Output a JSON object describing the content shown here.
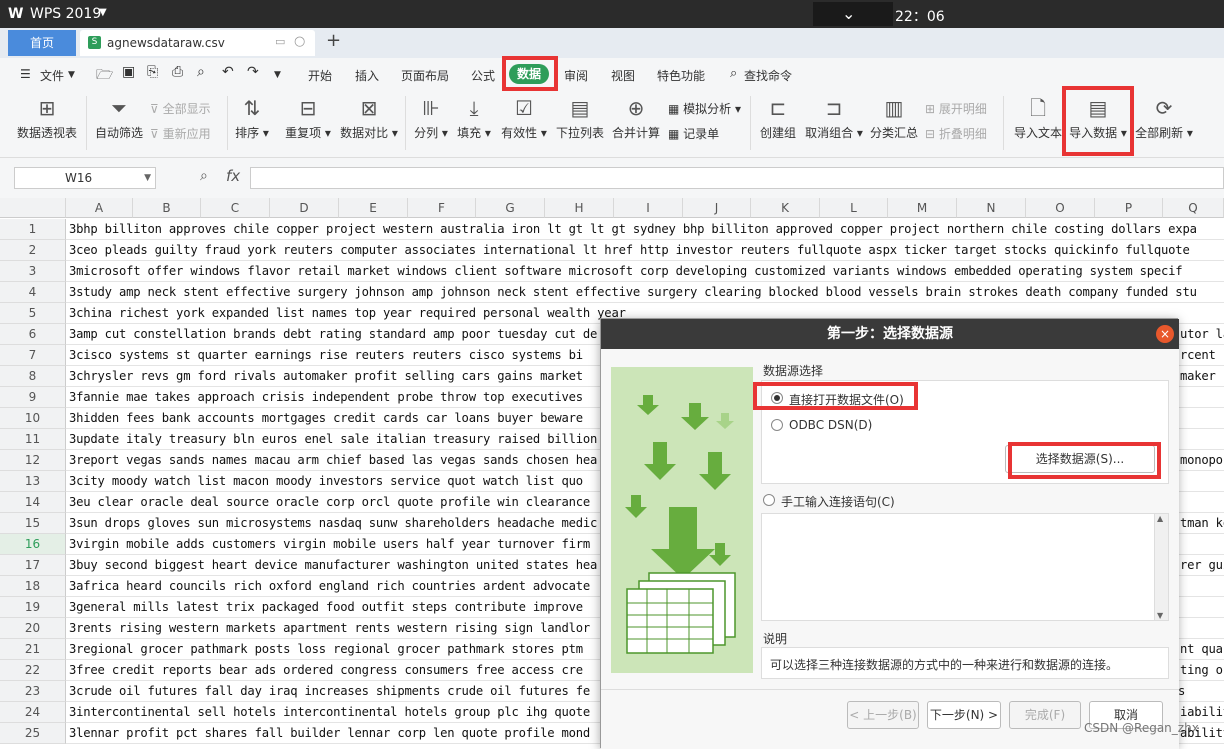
{
  "titlebar": {
    "logo": "W",
    "app": "WPS 2019",
    "clock": "22：06"
  },
  "tabs": {
    "home": "首页",
    "file": "agnewsdataraw.csv",
    "file_badge": "S"
  },
  "menu": {
    "file": "文件",
    "items": [
      "开始",
      "插入",
      "页面布局",
      "公式",
      "数据",
      "审阅",
      "视图",
      "特色功能"
    ],
    "search": "查找命令"
  },
  "ribbon": {
    "pivot": "数据透视表",
    "autofilter": "自动筛选",
    "show_all": "全部显示",
    "reapply": "重新应用",
    "sort": "排序",
    "duplicates": "重复项",
    "compare": "数据对比",
    "split": "分列",
    "fill": "填充",
    "validity": "有效性",
    "dropdown": "下拉列表",
    "consolidate": "合并计算",
    "simulate": "模拟分析",
    "record": "记录单",
    "create_group": "创建组",
    "ungroup": "取消组合",
    "subtotal": "分类汇总",
    "expand": "展开明细",
    "collapse": "折叠明细",
    "import_text": "导入文本",
    "import_data": "导入数据",
    "refresh_all": "全部刷新"
  },
  "formula": {
    "cell_ref": "W16",
    "fx": "fx"
  },
  "columns": [
    "A",
    "B",
    "C",
    "D",
    "E",
    "F",
    "G",
    "H",
    "I",
    "J",
    "K",
    "L",
    "M",
    "N",
    "O",
    "P",
    "Q"
  ],
  "selected_row": 16,
  "rows": [
    {
      "n": "1",
      "text": "3bhp billiton approves chile copper project western australia iron lt gt lt gt sydney bhp billiton approved copper project northern chile costing dollars expa"
    },
    {
      "n": "2",
      "text": "3ceo pleads guilty fraud york reuters computer associates international lt href http investor reuters fullquote aspx ticker target stocks quickinfo fullquote"
    },
    {
      "n": "3",
      "text": "3microsoft offer windows flavor retail market windows client software microsoft corp developing customized variants windows embedded operating system specif"
    },
    {
      "n": "4",
      "text": "3study amp neck stent effective surgery johnson amp johnson neck stent effective surgery clearing blocked blood vessels brain strokes death company funded stu"
    },
    {
      "n": "5",
      "text": "3china richest york expanded list names top year required personal wealth year"
    },
    {
      "n": "6",
      "text": "3amp cut constellation brands debt rating standard amp poor tuesday cut de"
    },
    {
      "n": "7",
      "text": "3cisco systems st quarter earnings rise reuters reuters cisco systems bi"
    },
    {
      "n": "8",
      "text": "3chrysler revs gm ford rivals automaker profit selling cars gains market"
    },
    {
      "n": "9",
      "text": "3fannie mae takes approach crisis independent probe throw top executives"
    },
    {
      "n": "10",
      "text": "3hidden fees bank accounts mortgages credit cards car loans buyer beware"
    },
    {
      "n": "11",
      "text": "3update italy treasury bln euros enel sale italian treasury raised billion"
    },
    {
      "n": "12",
      "text": "3report vegas sands names macau arm chief based las vegas sands chosen hea"
    },
    {
      "n": "13",
      "text": "3city moody watch list macon moody investors service quot watch list quo"
    },
    {
      "n": "14",
      "text": "3eu clear oracle deal source oracle corp orcl quote profile win clearance"
    },
    {
      "n": "15",
      "text": "3sun drops gloves sun microsystems nasdaq sunw shareholders headache medic"
    },
    {
      "n": "16",
      "text": "3virgin mobile adds customers virgin mobile users half year turnover firm"
    },
    {
      "n": "17",
      "text": "3buy second biggest heart device manufacturer washington united states hea"
    },
    {
      "n": "18",
      "text": "3africa heard councils rich oxford england rich countries ardent advocate"
    },
    {
      "n": "19",
      "text": "3general mills latest trix packaged food outfit steps contribute improve"
    },
    {
      "n": "20",
      "text": "3rents rising western markets apartment rents western rising sign landlor"
    },
    {
      "n": "21",
      "text": "3regional grocer pathmark posts loss regional grocer pathmark stores ptm"
    },
    {
      "n": "22",
      "text": "3free credit reports bear ads ordered congress consumers free access cre"
    },
    {
      "n": "23",
      "text": "3crude oil futures fall day iraq increases shipments crude oil futures fe"
    },
    {
      "n": "24",
      "text": "3intercontinental sell hotels intercontinental hotels group plc ihg quote"
    },
    {
      "n": "25",
      "text": "3lennar profit pct shares fall builder lennar corp len quote profile mond"
    }
  ],
  "right_overflow": {
    "r6": "utor la",
    "r7": "rcent r",
    "r8": "maker r",
    "r12": "monopo",
    "r15": "tman ko",
    "r17": "rer gui",
    "r21": "nt quar",
    "r22": "ting op",
    "r23": "s",
    "r24": "iability",
    "r25": "ability"
  },
  "dialog": {
    "title": "第一步：选择数据源",
    "close": "×",
    "section_source": "数据源选择",
    "opt_direct": "直接打开数据文件(O)",
    "opt_odbc": "ODBC DSN(D)",
    "btn_choose": "选择数据源(S)...",
    "opt_manual": "手工输入连接语句(C)",
    "section_desc": "说明",
    "desc": "可以选择三种连接数据源的方式中的一种来进行和数据源的连接。",
    "btn_prev": "< 上一步(B)",
    "btn_next": "下一步(N) >",
    "btn_finish": "完成(F)",
    "btn_cancel": "取消"
  },
  "watermark": "CSDN @Regan_zhx",
  "colors": {
    "accent": "#2e9d5a",
    "highlight": "#e83434",
    "home_tab": "#4a8bdc"
  }
}
